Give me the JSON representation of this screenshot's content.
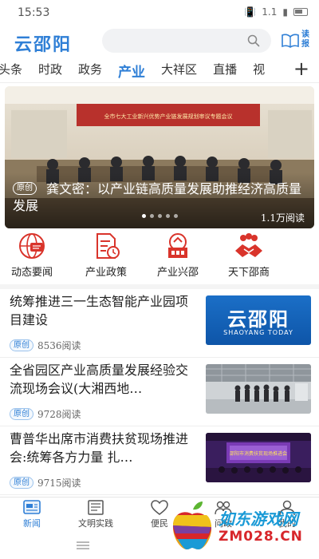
{
  "status_bar": {
    "time": "15:53",
    "network": "1.1"
  },
  "header": {
    "logo": "云邵阳",
    "search_placeholder": "",
    "read_label_1": "读",
    "read_label_2": "报"
  },
  "channels": {
    "items": [
      "头条",
      "时政",
      "政务",
      "产业",
      "大祥区",
      "直播",
      "视"
    ],
    "active_index": 3,
    "add_symbol": "+"
  },
  "banner": {
    "tag": "原创",
    "title": "龚文密：以产业链高质量发展助推经济高质量发展",
    "reads": "1.1万阅读",
    "dots": 5,
    "active_dot": 0,
    "photo_caption": "全市七大工业新兴优势产业链发展规划审议专题会议"
  },
  "quick_nav": [
    {
      "label": "动态要闻",
      "icon": "globe-news-icon"
    },
    {
      "label": "产业政策",
      "icon": "policy-document-icon"
    },
    {
      "label": "产业兴邵",
      "icon": "industry-building-icon"
    },
    {
      "label": "天下邵商",
      "icon": "handshake-icon"
    }
  ],
  "news": [
    {
      "title": "统筹推进三一生态智能产业园项目建设",
      "tag": "原创",
      "reads": "8536阅读",
      "thumb_logo": "云邵阳",
      "thumb_sub": "SHAOYANG TODAY"
    },
    {
      "title": "全省园区产业高质量发展经验交流现场会议(大湘西地…",
      "tag": "原创",
      "reads": "9728阅读"
    },
    {
      "title": "曹普华出席市消费扶贫现场推进会:统筹各方力量 扎…",
      "tag": "原创",
      "reads": "9715阅读",
      "thumb_caption": "邵阳市消费扶贫现场推进会"
    }
  ],
  "bottom_nav": [
    {
      "label": "新闻",
      "icon": "news-icon",
      "active": true
    },
    {
      "label": "文明实践",
      "icon": "newspaper-icon",
      "active": false
    },
    {
      "label": "便民",
      "icon": "heart-icon",
      "active": false
    },
    {
      "label": "问政",
      "icon": "people-icon",
      "active": false
    },
    {
      "label": "我的",
      "icon": "user-icon",
      "active": false
    }
  ],
  "watermark": {
    "text": "如东游戏网",
    "url": "ZM028.CN"
  },
  "colors": {
    "accent": "#2f7fd6",
    "red_icon": "#d9342b",
    "tag_border": "#9cc3ec"
  }
}
